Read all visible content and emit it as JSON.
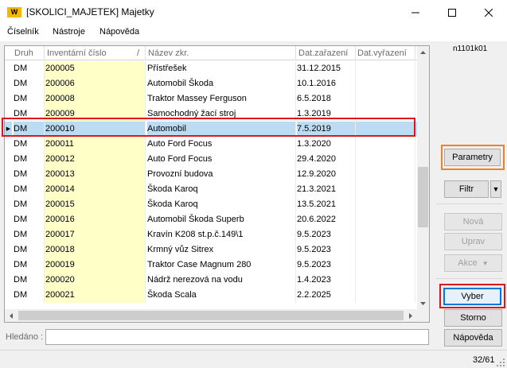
{
  "window": {
    "logo_text": "W",
    "title": "[SKOLICI_MAJETEK] Majetky",
    "minimize_glyph": "─",
    "maximize_glyph": "☐",
    "close_glyph": "✕"
  },
  "menu": {
    "items": [
      {
        "label": "Číselník"
      },
      {
        "label": "Nástroje"
      },
      {
        "label": "Nápověda"
      }
    ]
  },
  "grid": {
    "columns": {
      "druh": "Druh",
      "inventarni_cislo": "Inventární číslo",
      "sort_marker": "/",
      "nazev": "Název zkr.",
      "dat_zarazeni": "Dat.zařazení",
      "dat_vyrazeni": "Dat.vyřazení"
    },
    "selected_indicator": "▶",
    "selected_index": 4,
    "rows": [
      {
        "druh": "DM",
        "inv": "200005",
        "nazev": "Přístřešek",
        "datz": "31.12.2015",
        "datv": ""
      },
      {
        "druh": "DM",
        "inv": "200006",
        "nazev": "Automobil Škoda",
        "datz": "10.1.2016",
        "datv": ""
      },
      {
        "druh": "DM",
        "inv": "200008",
        "nazev": "Traktor Massey Ferguson",
        "datz": "6.5.2018",
        "datv": ""
      },
      {
        "druh": "DM",
        "inv": "200009",
        "nazev": "Samochodný žací stroj",
        "datz": "1.3.2019",
        "datv": ""
      },
      {
        "druh": "DM",
        "inv": "200010",
        "nazev": "Automobil",
        "datz": "7.5.2019",
        "datv": ""
      },
      {
        "druh": "DM",
        "inv": "200011",
        "nazev": "Auto Ford Focus",
        "datz": "1.3.2020",
        "datv": ""
      },
      {
        "druh": "DM",
        "inv": "200012",
        "nazev": "Auto Ford Focus",
        "datz": "29.4.2020",
        "datv": ""
      },
      {
        "druh": "DM",
        "inv": "200013",
        "nazev": "Provozní budova",
        "datz": "12.9.2020",
        "datv": ""
      },
      {
        "druh": "DM",
        "inv": "200014",
        "nazev": "Škoda Karoq",
        "datz": "21.3.2021",
        "datv": ""
      },
      {
        "druh": "DM",
        "inv": "200015",
        "nazev": "Škoda Karoq",
        "datz": "13.5.2021",
        "datv": ""
      },
      {
        "druh": "DM",
        "inv": "200016",
        "nazev": "Automobil Škoda Superb",
        "datz": "20.6.2022",
        "datv": ""
      },
      {
        "druh": "DM",
        "inv": "200017",
        "nazev": "Kravín K208 st.p.č.149\\1",
        "datz": "9.5.2023",
        "datv": ""
      },
      {
        "druh": "DM",
        "inv": "200018",
        "nazev": "Krmný vůz Sitrex",
        "datz": "9.5.2023",
        "datv": ""
      },
      {
        "druh": "DM",
        "inv": "200019",
        "nazev": "Traktor Case Magnum 280",
        "datz": "9.5.2023",
        "datv": ""
      },
      {
        "druh": "DM",
        "inv": "200020",
        "nazev": "Nádrž nerezová na vodu",
        "datz": "1.4.2023",
        "datv": ""
      },
      {
        "druh": "DM",
        "inv": "200021",
        "nazev": "Škoda Scala",
        "datz": "2.2.2025",
        "datv": ""
      }
    ]
  },
  "search": {
    "label": "Hledáno :",
    "value": ""
  },
  "panel": {
    "code": "n1101k01",
    "buttons": {
      "parametry": "Parametry",
      "filtr": "Filtr",
      "filtr_drop": "▼",
      "nova": "Nová",
      "uprav": "Uprav",
      "akce": "Akce",
      "akce_drop": "▼",
      "vyber": "Vyber",
      "storno": "Storno",
      "napoveda": "Nápověda"
    }
  },
  "status": {
    "count": "32/61"
  },
  "colors": {
    "selected_row": "#bcdcf4",
    "inventory_cell": "#ffffc8",
    "highlight_red": "#e0141e",
    "highlight_orange": "#f08020",
    "focus_blue": "#0078d7",
    "logo": "#f5b800"
  }
}
